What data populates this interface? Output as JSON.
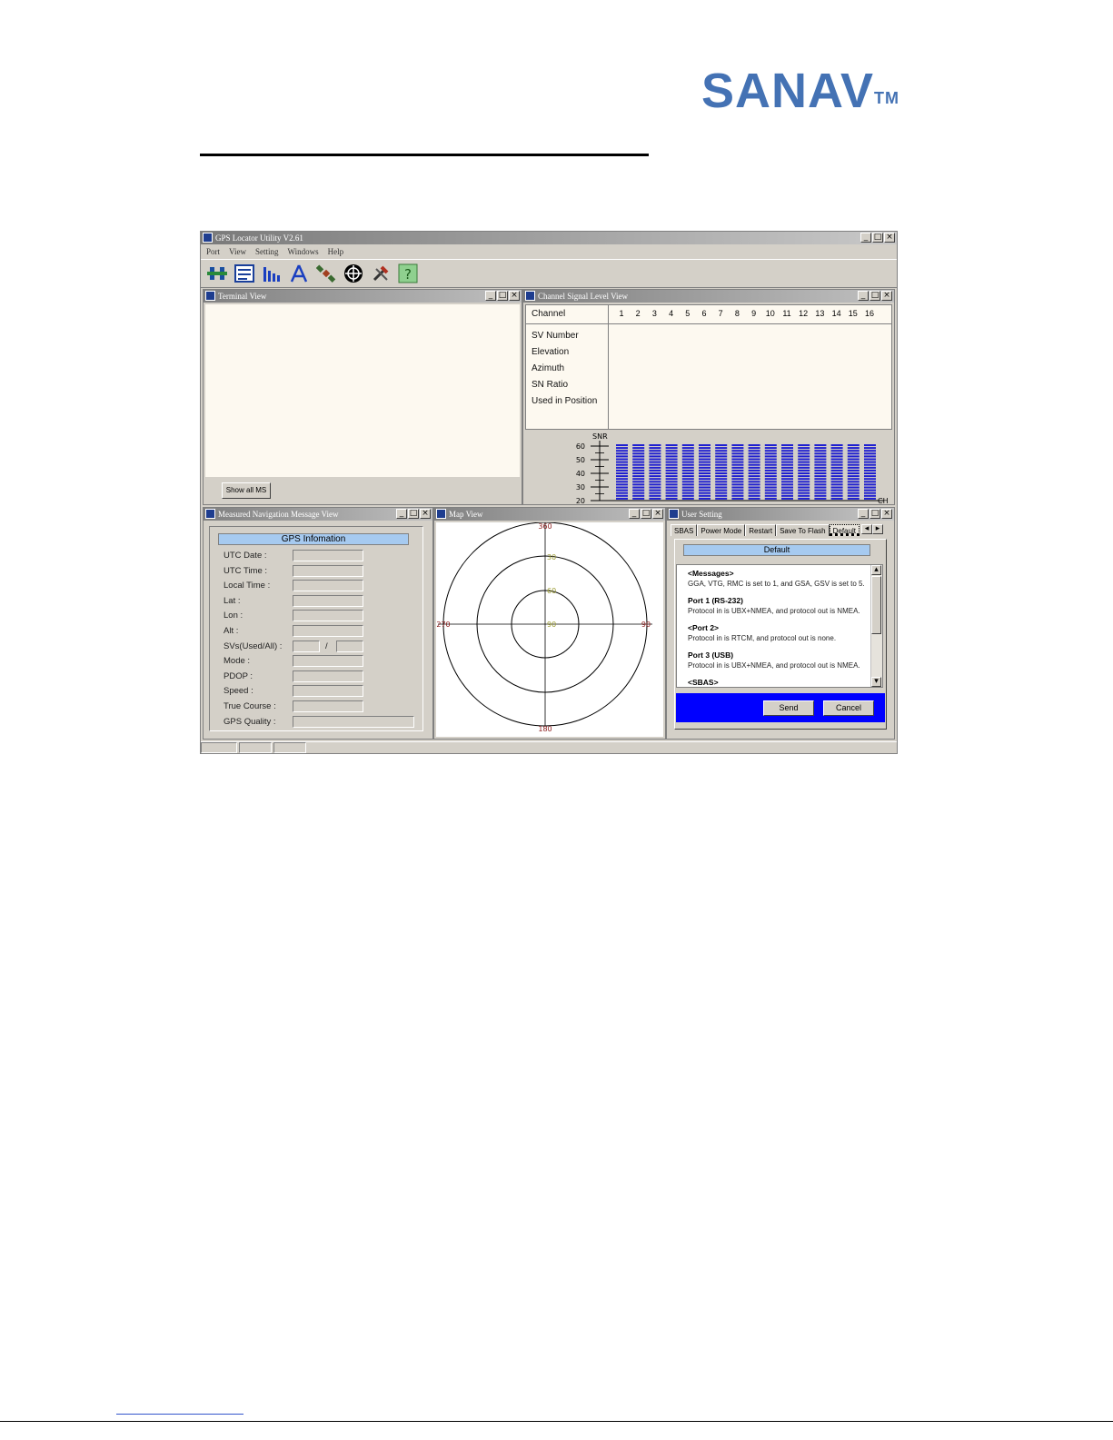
{
  "logo": {
    "text": "SANAV",
    "tm": "TM"
  },
  "app": {
    "title": "GPS Locator Utility V2.61",
    "menu": [
      "Port",
      "View",
      "Setting",
      "Windows",
      "Help"
    ],
    "toolbar_icons": [
      "connect-icon",
      "terminal-icon",
      "signal-icon",
      "compass-icon",
      "satellite-icon",
      "target-icon",
      "tools-icon",
      "help-icon"
    ]
  },
  "terminal": {
    "title": "Terminal View",
    "show_all_btn": "Show all MS"
  },
  "channel": {
    "title": "Channel Signal Level View",
    "header_label": "Channel",
    "channels": [
      "1",
      "2",
      "3",
      "4",
      "5",
      "6",
      "7",
      "8",
      "9",
      "10",
      "11",
      "12",
      "13",
      "14",
      "15",
      "16"
    ],
    "rows": [
      "SV Number",
      "Elevation",
      "Azimuth",
      "SN Ratio",
      "Used in Position"
    ],
    "snr_label": "SNR",
    "ch_label": "CH",
    "snr_ticks": [
      "60",
      "50",
      "40",
      "30",
      "20"
    ]
  },
  "measured": {
    "title": "Measured Navigation Message View",
    "header": "GPS Infomation",
    "labels": [
      "UTC Date :",
      "UTC Time :",
      "Local Time :",
      "Lat :",
      "Lon :",
      "Alt :",
      "SVs(Used/All) :",
      "Mode :",
      "PDOP :",
      "Speed :",
      "True Course :",
      "GPS Quality :"
    ],
    "sv_sep": "/"
  },
  "map": {
    "title": "Map View",
    "labels": {
      "top": "360",
      "bottom": "180",
      "left": "270",
      "right": "90",
      "ring1": "30",
      "ring2": "60",
      "center": "90"
    }
  },
  "user_setting": {
    "title": "User Setting",
    "tabs": [
      "SBAS",
      "Power Mode",
      "Restart",
      "Save To Flash",
      "Default"
    ],
    "default_bar": "Default",
    "messages": [
      {
        "head": "<Messages>",
        "text": "GGA, VTG, RMC is set to 1, and GSA, GSV is set to 5."
      },
      {
        "head": "Port 1 (RS-232)",
        "text": "Protocol in is UBX+NMEA, and protocol out is NMEA."
      },
      {
        "head": "<Port 2>",
        "text": "Protocol in is RTCM, and protocol out is none."
      },
      {
        "head": "Port 3 (USB)",
        "text": "Protocol in is UBX+NMEA, and protocol out is NMEA."
      },
      {
        "head": "<SBAS>",
        "text": ""
      }
    ],
    "send": "Send",
    "cancel": "Cancel"
  },
  "colors": {
    "logo": "#4472b4",
    "bars": "#1f1fd0",
    "highlight": "#a6caf0",
    "dialog_blue": "#0000ff"
  }
}
